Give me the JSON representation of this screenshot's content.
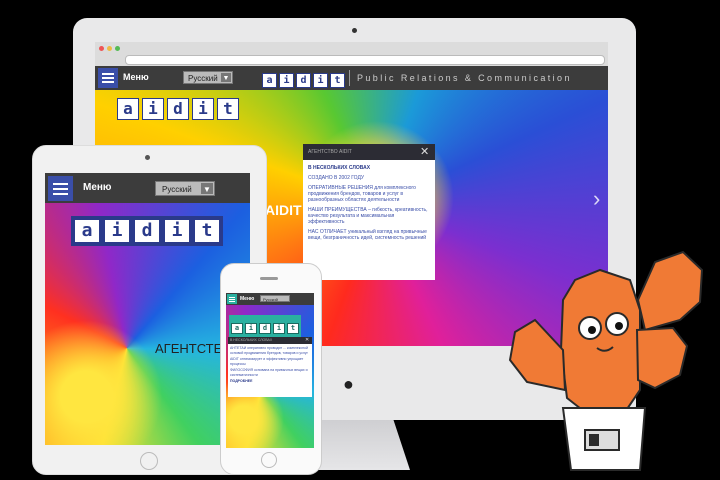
{
  "desktop": {
    "menu_label": "Меню",
    "lang": "Русский",
    "logo_letters": [
      "a",
      "i",
      "d",
      "i",
      "t"
    ],
    "tagline": "Public Relations & Communication",
    "popup": {
      "header": "АГЕНТСТВО AIDIT",
      "heading": "В НЕСКОЛЬКИХ СЛОВАХ",
      "p1": "СОЗДАНО В 2002 ГОДУ",
      "p2": "ОПЕРАТИВНЫЕ РЕШЕНИЯ для комплексного продвижения брендов, товаров и услуг в разнообразных областях деятельности",
      "p3": "НАШИ ПРЕИМУЩЕСТВА – гибкость, креативность, качество результата и максимальная эффективность",
      "p4": "НАС ОТЛИЧАЕТ уникальный взгляд на привычные вещи, безграничность идей, системность решений"
    },
    "overlay_text": "AIDIT"
  },
  "tablet": {
    "menu_label": "Меню",
    "lang": "Русский",
    "logo_letters": [
      "a",
      "i",
      "d",
      "i",
      "t"
    ],
    "overlay_text": "АГЕНТСТЕ"
  },
  "phone": {
    "menu_label": "Меню",
    "lang": "Русский",
    "logo_letters": [
      "a",
      "i",
      "d",
      "i",
      "t"
    ],
    "popup_heading": "В НЕСКОЛЬКИХ СЛОВАХ",
    "popup_p1": "АНТЕТАИ оперативно проводит ... комплексной основой продвижения брендов, товаров и услуг",
    "popup_p2": "AIDIT оптимизирует и эффективно упрощает процессы",
    "popup_p3": "ФИЛОСОФИЯ основана на привычных вещах и систематичности",
    "popup_more": "ПОДРОБНЕЕ"
  },
  "colors": {
    "nav_bg": "#3c3c3c",
    "accent_blue": "#3a4ea8",
    "phone_accent": "#2ab0a0",
    "cactus": "#f07a35"
  }
}
